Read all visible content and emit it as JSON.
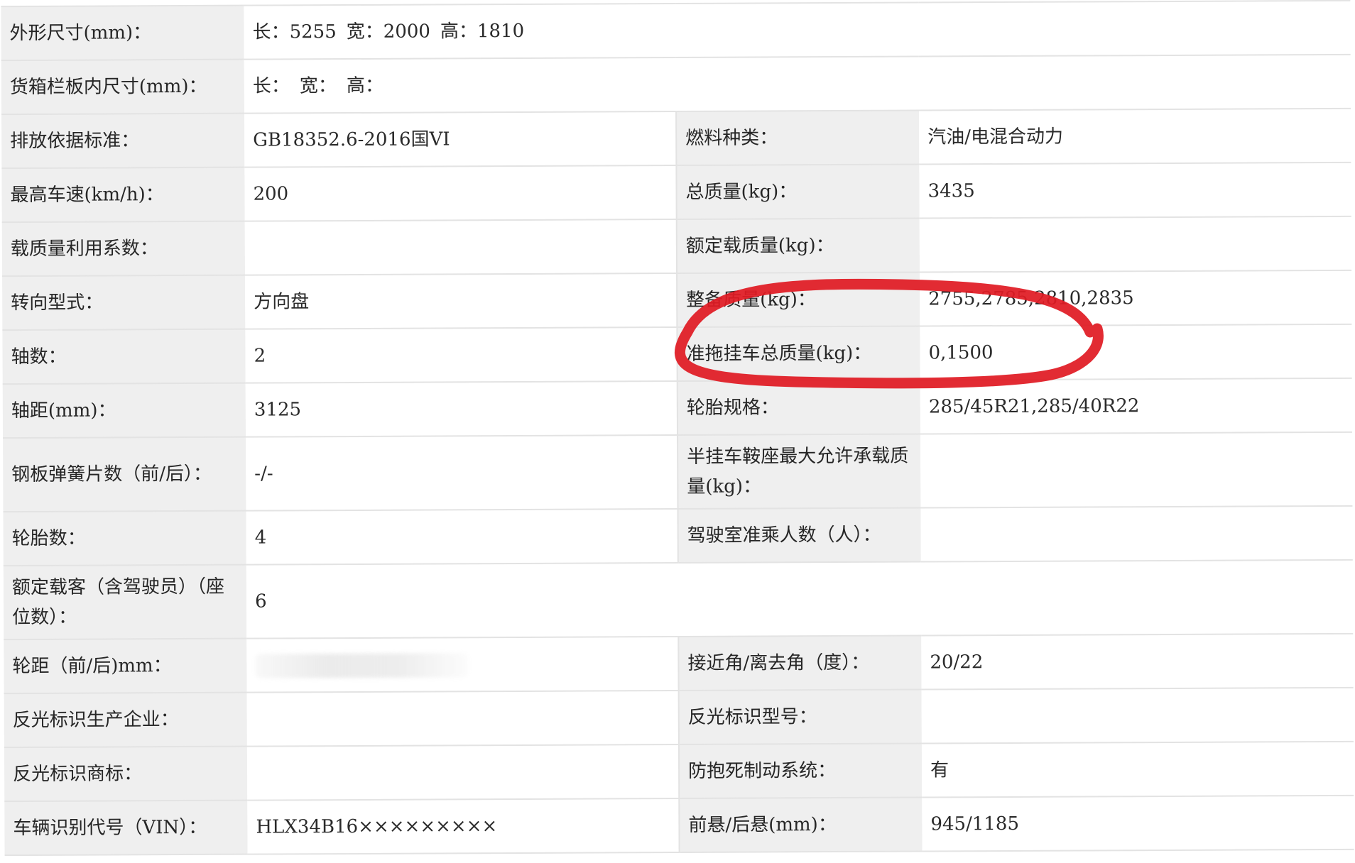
{
  "rows": [
    {
      "l1": "外形尺寸(mm)：",
      "dim": {
        "len_label": "长：",
        "len": "5255",
        "wid_label": "宽：",
        "wid": "2000",
        "hei_label": "高：",
        "hei": "1810"
      }
    },
    {
      "l1": "货箱栏板内尺寸(mm)：",
      "dim": {
        "len_label": "长：",
        "wid_label": "宽：",
        "hei_label": "高："
      }
    },
    {
      "l1": "排放依据标准：",
      "v1": "GB18352.6-2016国VI",
      "l2": "燃料种类：",
      "v2": "汽油/电混合动力"
    },
    {
      "l1": "最高车速(km/h)：",
      "v1": "200",
      "l2": "总质量(kg)：",
      "v2": "3435"
    },
    {
      "l1": "载质量利用系数：",
      "v1": "",
      "l2": "额定载质量(kg)：",
      "v2": ""
    },
    {
      "l1": "转向型式：",
      "v1": "方向盘",
      "l2": "整备质量(kg)：",
      "v2": "2755,2785,2810,2835"
    },
    {
      "l1": "轴数：",
      "v1": "2",
      "l2": "准拖挂车总质量(kg)：",
      "v2": "0,1500"
    },
    {
      "l1": "轴距(mm)：",
      "v1": "3125",
      "l2": "轮胎规格：",
      "v2": "285/45R21,285/40R22"
    },
    {
      "l1": "钢板弹簧片数（前/后）：",
      "v1": "-/-",
      "l2": "半挂车鞍座最大允许承载质量(kg)：",
      "v2": ""
    },
    {
      "l1": "轮胎数：",
      "v1": "4",
      "l2": "驾驶室准乘人数（人）：",
      "v2": ""
    },
    {
      "l1": "额定载客（含驾驶员）（座位数）：",
      "v1": "6"
    },
    {
      "l1": "轮距（前/后)mm：",
      "v1": "",
      "l2": "接近角/离去角（度）：",
      "v2": "20/22"
    },
    {
      "l1": "反光标识生产企业：",
      "v1": "",
      "l2": "反光标识型号：",
      "v2": ""
    },
    {
      "l1": "反光标识商标：",
      "v1": "",
      "l2": "防抱死制动系统：",
      "v2": "有"
    },
    {
      "l1": "车辆识别代号（VIN）：",
      "v1": "HLX34B16×××××××××",
      "l2": "前悬/后悬(mm)：",
      "v2": "945/1185"
    }
  ],
  "annotation": {
    "color": "#e01b24"
  }
}
